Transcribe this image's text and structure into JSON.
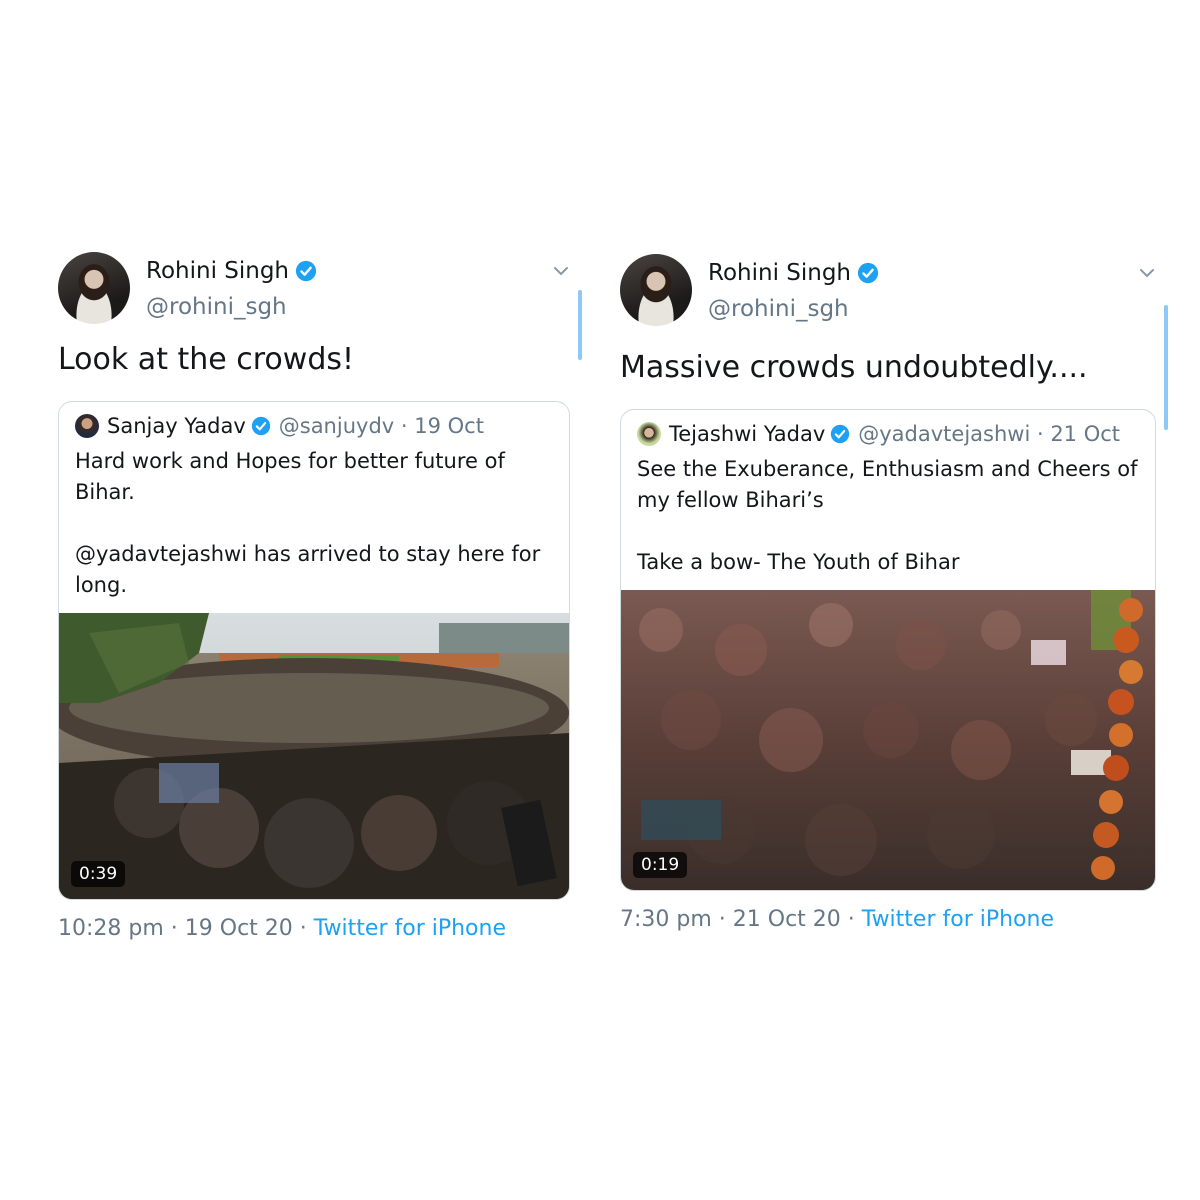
{
  "left_tweet": {
    "author": {
      "name": "Rohini Singh",
      "handle": "@rohini_sgh"
    },
    "text": "Look at the crowds!",
    "quote": {
      "name": "Sanjay Yadav",
      "meta": "@sanjuydv · 19 Oct",
      "text": "Hard work and Hopes for better future of Bihar.\n\n@yadavtejashwi has arrived to stay here for long.",
      "video_duration": "0:39"
    },
    "footer": {
      "time": "10:28 pm · 19 Oct 20 · ",
      "source": "Twitter for iPhone"
    }
  },
  "right_tweet": {
    "author": {
      "name": "Rohini Singh",
      "handle": "@rohini_sgh"
    },
    "text": "Massive crowds undoubtedly....",
    "quote": {
      "name": "Tejashwi Yadav",
      "meta": "@yadavtejashwi · 21 Oct",
      "text": "See the Exuberance, Enthusiasm and Cheers of my fellow Bihari’s\n\nTake a bow- The Youth of Bihar",
      "video_duration": "0:19"
    },
    "footer": {
      "time": "7:30 pm · 21 Oct 20 · ",
      "source": "Twitter for iPhone"
    }
  },
  "colors": {
    "link": "#1da1f2",
    "secondary_text": "#657786",
    "border": "#cfd9de",
    "verified": "#1da1f2"
  },
  "icons": [
    "verified-badge-icon",
    "chevron-down-icon"
  ]
}
